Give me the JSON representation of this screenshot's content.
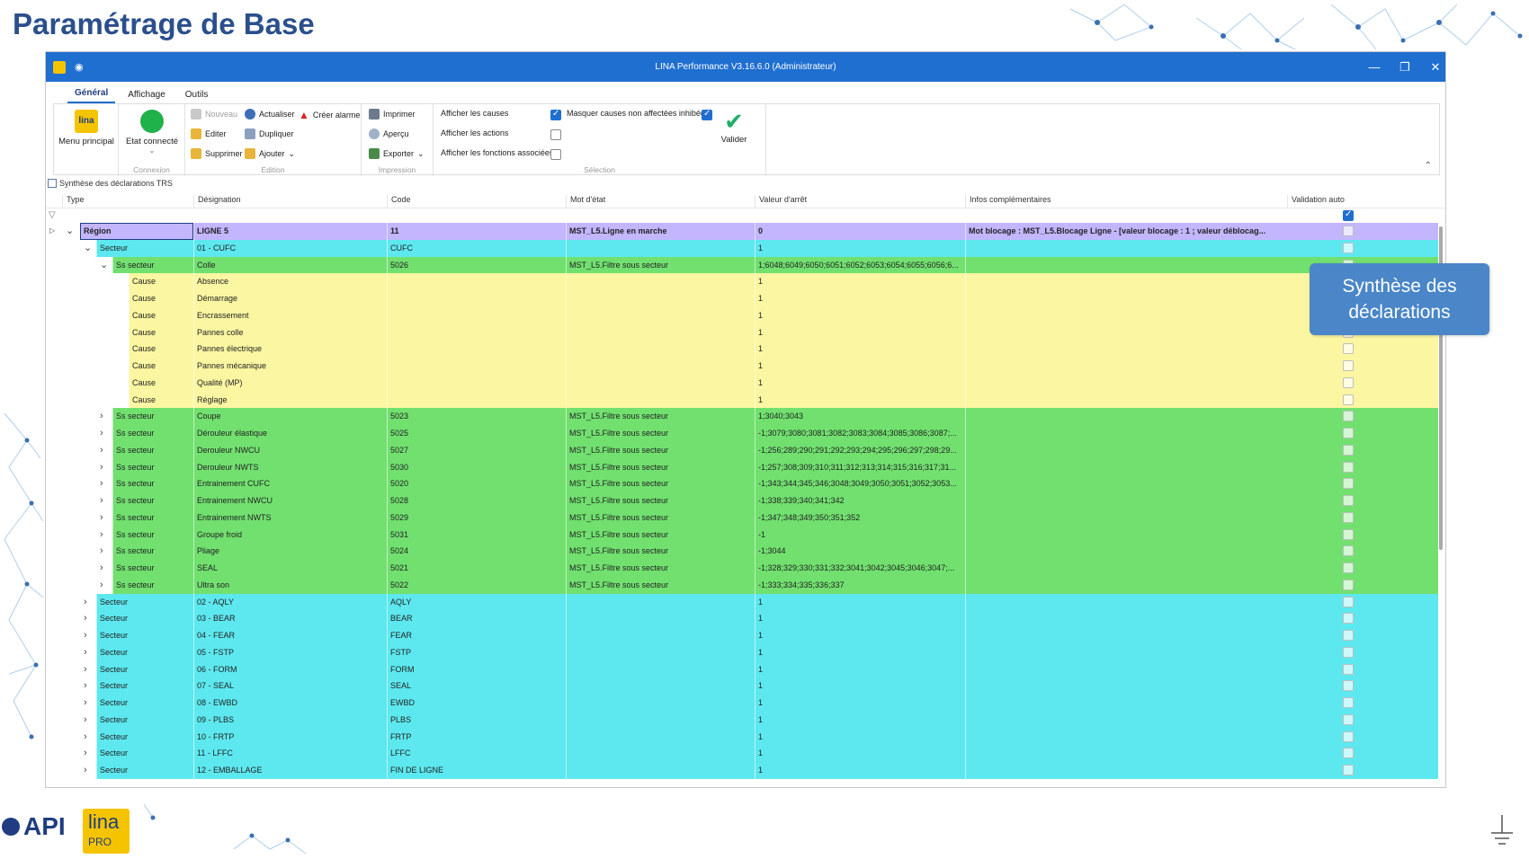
{
  "slide_title": "Paramétrage de Base",
  "window": {
    "title": "LINA Performance  V3.16.6.0  (Administrateur)"
  },
  "menu_tabs": [
    "Général",
    "Affichage",
    "Outils"
  ],
  "ribbon": {
    "menu_principal": "Menu principal",
    "etat_connecte": "Etat connecté",
    "connexion_group": "Connexion",
    "nouveau": "Nouveau",
    "actualiser": "Actualiser",
    "creer_alarme": "Créer alarme",
    "editer": "Editer",
    "dupliquer": "Dupliquer",
    "supprimer": "Supprimer",
    "ajouter": "Ajouter",
    "edition_group": "Edition",
    "imprimer": "Imprimer",
    "apercu": "Aperçu",
    "exporter": "Exporter",
    "impression_group": "Impression",
    "afficher_causes": "Afficher les causes",
    "masquer_causes": "Masquer causes non affectées inhibées",
    "afficher_actions": "Afficher les actions",
    "afficher_fonctions": "Afficher les fonctions associées",
    "selection_group": "Sélection",
    "valider": "Valider"
  },
  "grid_title": "Synthèse des déclarations TRS",
  "columns": [
    "Type",
    "Désignation",
    "Code",
    "Mot d'état",
    "Valeur d'arrêt",
    "Infos complémentaires",
    "Validation auto"
  ],
  "rows": [
    {
      "type": "Région",
      "des": "LIGNE 5",
      "code": "11",
      "mot": "MST_L5.Ligne en marche",
      "val": "0",
      "info": "Mot blocage : MST_L5.Blocage Ligne - [valeur blocage : 1 ; valeur déblocag..."
    },
    {
      "type": "Secteur",
      "des": "01 - CUFC",
      "code": "CUFC",
      "mot": "",
      "val": "1",
      "info": ""
    },
    {
      "type": "Ss secteur",
      "des": "Colle",
      "code": "5026",
      "mot": "MST_L5.Filtre sous secteur",
      "val": "1;6048;6049;6050;6051;6052;6053;6054;6055;6056;6...",
      "info": ""
    },
    {
      "type": "Cause",
      "des": "Absence",
      "code": "",
      "mot": "",
      "val": "1",
      "info": ""
    },
    {
      "type": "Cause",
      "des": "Démarrage",
      "code": "",
      "mot": "",
      "val": "1",
      "info": ""
    },
    {
      "type": "Cause",
      "des": "Encrassement",
      "code": "",
      "mot": "",
      "val": "1",
      "info": ""
    },
    {
      "type": "Cause",
      "des": "Pannes colle",
      "code": "",
      "mot": "",
      "val": "1",
      "info": ""
    },
    {
      "type": "Cause",
      "des": "Pannes électrique",
      "code": "",
      "mot": "",
      "val": "1",
      "info": ""
    },
    {
      "type": "Cause",
      "des": "Pannes mécanique",
      "code": "",
      "mot": "",
      "val": "1",
      "info": ""
    },
    {
      "type": "Cause",
      "des": "Qualité (MP)",
      "code": "",
      "mot": "",
      "val": "1",
      "info": ""
    },
    {
      "type": "Cause",
      "des": "Réglage",
      "code": "",
      "mot": "",
      "val": "1",
      "info": ""
    },
    {
      "type": "Ss secteur",
      "des": "Coupe",
      "code": "5023",
      "mot": "MST_L5.Filtre sous secteur",
      "val": "1;3040;3043",
      "info": ""
    },
    {
      "type": "Ss secteur",
      "des": "Dérouleur élastique",
      "code": "5025",
      "mot": "MST_L5.Filtre sous secteur",
      "val": "-1;3079;3080;3081;3082;3083;3084;3085;3086;3087;...",
      "info": ""
    },
    {
      "type": "Ss secteur",
      "des": "Derouleur NWCU",
      "code": "5027",
      "mot": "MST_L5.Filtre sous secteur",
      "val": "-1;256;289;290;291;292;293;294;295;296;297;298;29...",
      "info": ""
    },
    {
      "type": "Ss secteur",
      "des": "Derouleur NWTS",
      "code": "5030",
      "mot": "MST_L5.Filtre sous secteur",
      "val": "-1;257;308;309;310;311;312;313;314;315;316;317;31...",
      "info": ""
    },
    {
      "type": "Ss secteur",
      "des": "Entrainement CUFC",
      "code": "5020",
      "mot": "MST_L5.Filtre sous secteur",
      "val": "-1;343;344;345;346;3048;3049;3050;3051;3052;3053...",
      "info": ""
    },
    {
      "type": "Ss secteur",
      "des": "Entrainement NWCU",
      "code": "5028",
      "mot": "MST_L5.Filtre sous secteur",
      "val": "-1;338;339;340;341;342",
      "info": ""
    },
    {
      "type": "Ss secteur",
      "des": "Entrainement NWTS",
      "code": "5029",
      "mot": "MST_L5.Filtre sous secteur",
      "val": "-1;347;348;349;350;351;352",
      "info": ""
    },
    {
      "type": "Ss secteur",
      "des": "Groupe froid",
      "code": "5031",
      "mot": "MST_L5.Filtre sous secteur",
      "val": "-1",
      "info": ""
    },
    {
      "type": "Ss secteur",
      "des": "Pliage",
      "code": "5024",
      "mot": "MST_L5.Filtre sous secteur",
      "val": "-1;3044",
      "info": ""
    },
    {
      "type": "Ss secteur",
      "des": "SEAL",
      "code": "5021",
      "mot": "MST_L5.Filtre sous secteur",
      "val": "-1;328;329;330;331;332;3041;3042;3045;3046;3047;...",
      "info": ""
    },
    {
      "type": "Ss secteur",
      "des": "Ultra son",
      "code": "5022",
      "mot": "MST_L5.Filtre sous secteur",
      "val": "-1;333;334;335;336;337",
      "info": ""
    },
    {
      "type": "Secteur",
      "des": "02 - AQLY",
      "code": "AQLY",
      "mot": "",
      "val": "1",
      "info": ""
    },
    {
      "type": "Secteur",
      "des": "03 - BEAR",
      "code": "BEAR",
      "mot": "",
      "val": "1",
      "info": ""
    },
    {
      "type": "Secteur",
      "des": "04 - FEAR",
      "code": "FEAR",
      "mot": "",
      "val": "1",
      "info": ""
    },
    {
      "type": "Secteur",
      "des": "05 - FSTP",
      "code": "FSTP",
      "mot": "",
      "val": "1",
      "info": ""
    },
    {
      "type": "Secteur",
      "des": "06 - FORM",
      "code": "FORM",
      "mot": "",
      "val": "1",
      "info": ""
    },
    {
      "type": "Secteur",
      "des": "07 - SEAL",
      "code": "SEAL",
      "mot": "",
      "val": "1",
      "info": ""
    },
    {
      "type": "Secteur",
      "des": "08 - EWBD",
      "code": "EWBD",
      "mot": "",
      "val": "1",
      "info": ""
    },
    {
      "type": "Secteur",
      "des": "09 - PLBS",
      "code": "PLBS",
      "mot": "",
      "val": "1",
      "info": ""
    },
    {
      "type": "Secteur",
      "des": "10 - FRTP",
      "code": "FRTP",
      "mot": "",
      "val": "1",
      "info": ""
    },
    {
      "type": "Secteur",
      "des": "11 - LFFC",
      "code": "LFFC",
      "mot": "",
      "val": "1",
      "info": ""
    },
    {
      "type": "Secteur",
      "des": "12 - EMBALLAGE",
      "code": "FIN DE LIGNE",
      "mot": "",
      "val": "1",
      "info": ""
    }
  ],
  "callout": "Synthèse des déclarations",
  "logos": {
    "api": "API",
    "lina": "lina",
    "pro": "PRO"
  },
  "colors": {
    "region": "#c3b6ff",
    "secteur": "#5de8ef",
    "ss_secteur": "#71e06f",
    "cause": "#fbf6a1",
    "accent": "#1f6fd1",
    "title": "#2b4f8c"
  }
}
